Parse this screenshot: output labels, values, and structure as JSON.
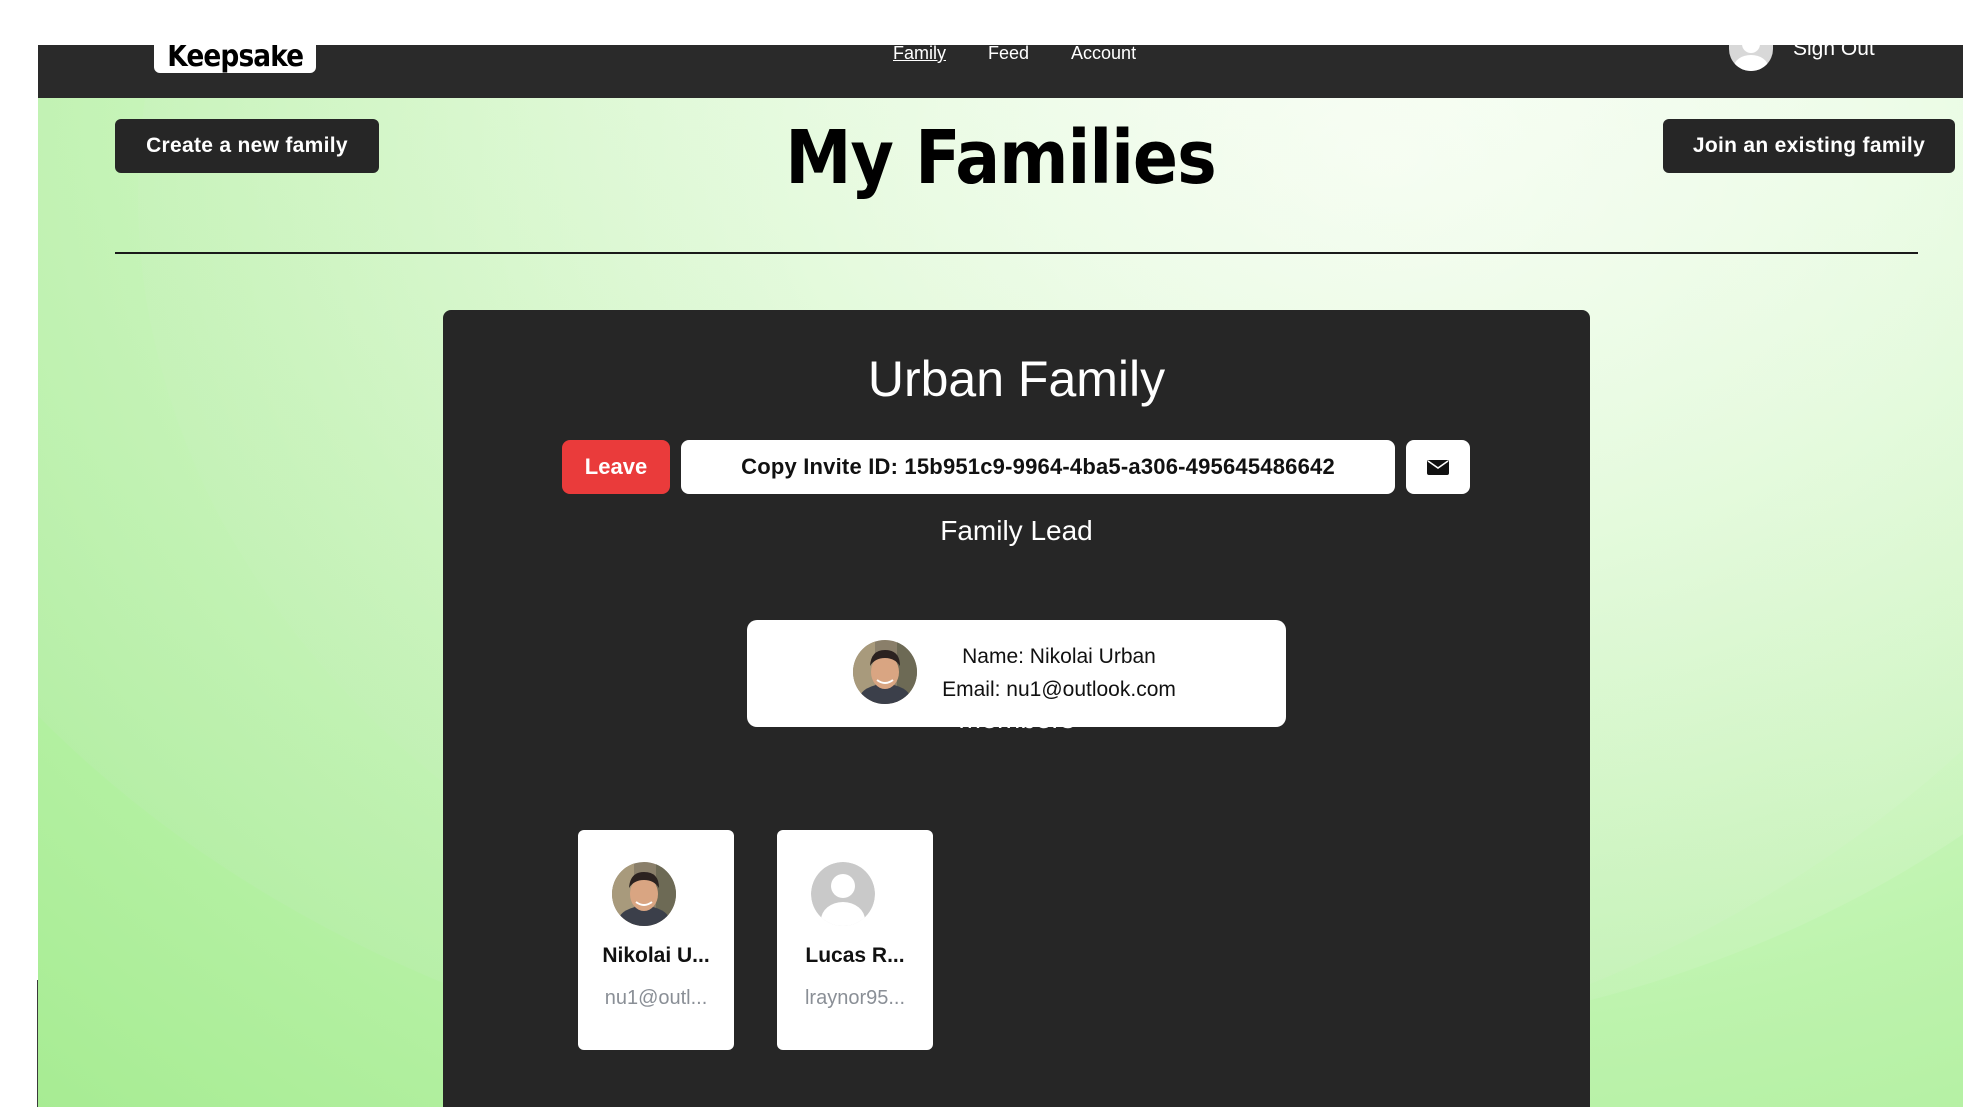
{
  "header": {
    "logo_text": "Keepsake",
    "nav": [
      {
        "label": "Family",
        "active": true
      },
      {
        "label": "Feed",
        "active": false
      },
      {
        "label": "Account",
        "active": false
      }
    ],
    "signout_label": "Sign Out"
  },
  "page": {
    "create_button": "Create a new family",
    "title": "My Families",
    "join_button": "Join an existing family"
  },
  "family": {
    "name": "Urban Family",
    "leave_button": "Leave",
    "invite_button": "Copy Invite ID: 15b951c9-9964-4ba5-a306-495645486642",
    "mail_icon": "envelope-icon",
    "lead_heading": "Family Lead",
    "lead": {
      "name_line": "Name: Nikolai Urban",
      "email_line": "Email: nu1@outlook.com"
    },
    "members_heading": "Members",
    "members": [
      {
        "name": "Nikolai U...",
        "email": "nu1@outl...",
        "avatar": "photo"
      },
      {
        "name": "Lucas R...",
        "email": "lraynor95...",
        "avatar": "default-user-icon"
      }
    ]
  },
  "colors": {
    "dark": "#262626",
    "leave_red": "#ea3b3b",
    "background_green": "#bdf3ad"
  }
}
